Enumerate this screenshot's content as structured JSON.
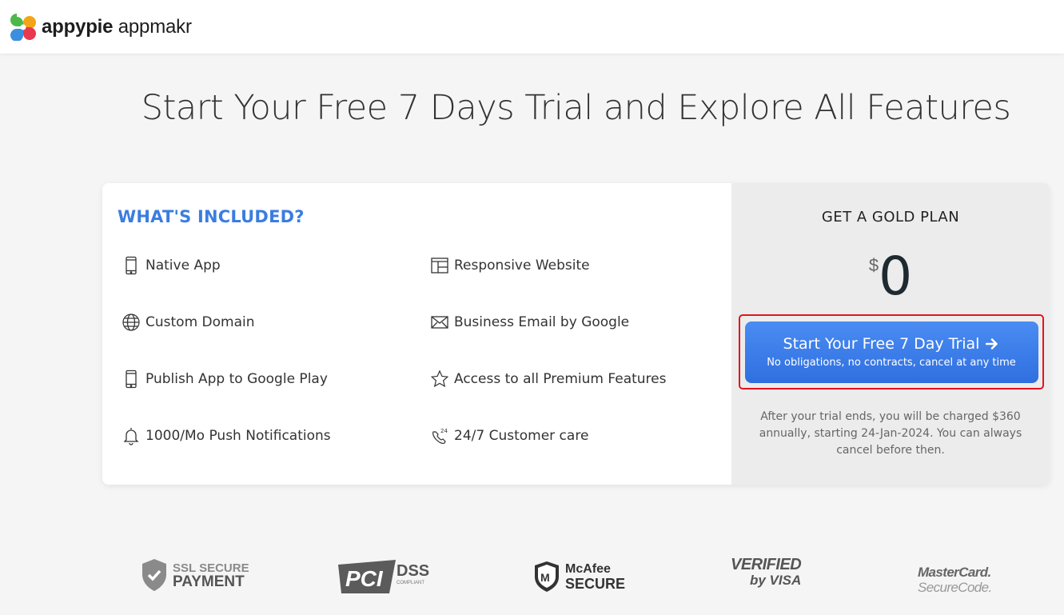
{
  "header": {
    "brand_bold": "appypie",
    "brand_light": "appmakr"
  },
  "headline": "Start Your Free 7 Days Trial and Explore All Features",
  "included": {
    "title": "WHAT'S INCLUDED?",
    "features": [
      {
        "label": "Native App",
        "icon": "mobile-icon"
      },
      {
        "label": "Responsive Website",
        "icon": "website-layout-icon"
      },
      {
        "label": "Custom Domain",
        "icon": "globe-icon"
      },
      {
        "label": "Business Email by Google",
        "icon": "envelope-icon"
      },
      {
        "label": "Publish App to Google Play",
        "icon": "mobile-icon"
      },
      {
        "label": "Access to all Premium Features",
        "icon": "star-icon"
      },
      {
        "label": "1000/Mo Push Notifications",
        "icon": "bell-icon"
      },
      {
        "label": "24/7 Customer care",
        "icon": "phone-24-icon"
      }
    ]
  },
  "plan": {
    "title": "GET A GOLD PLAN",
    "currency": "$",
    "amount": "0",
    "cta_main": "Start Your Free 7 Day Trial",
    "cta_sub": "No obligations, no contracts, cancel at any time",
    "note": "After your trial ends, you will be charged $360 annually, starting 24-Jan-2024. You can always cancel before then."
  },
  "badges": {
    "ssl_line1": "SSL SECURE",
    "ssl_line2": "PAYMENT",
    "pci": "PCI",
    "dss": "DSS",
    "dss_sub": "COMPLIANT",
    "mcafee_line1": "McAfee",
    "mcafee_line2": "SECURE",
    "visa_line1": "VERIFIED",
    "visa_line2": "by VISA",
    "mc_line1": "MasterCard.",
    "mc_line2": "SecureCode."
  },
  "colors": {
    "accent": "#3b7de0",
    "cta": "#3a7ce9",
    "highlight": "#e3141b"
  }
}
